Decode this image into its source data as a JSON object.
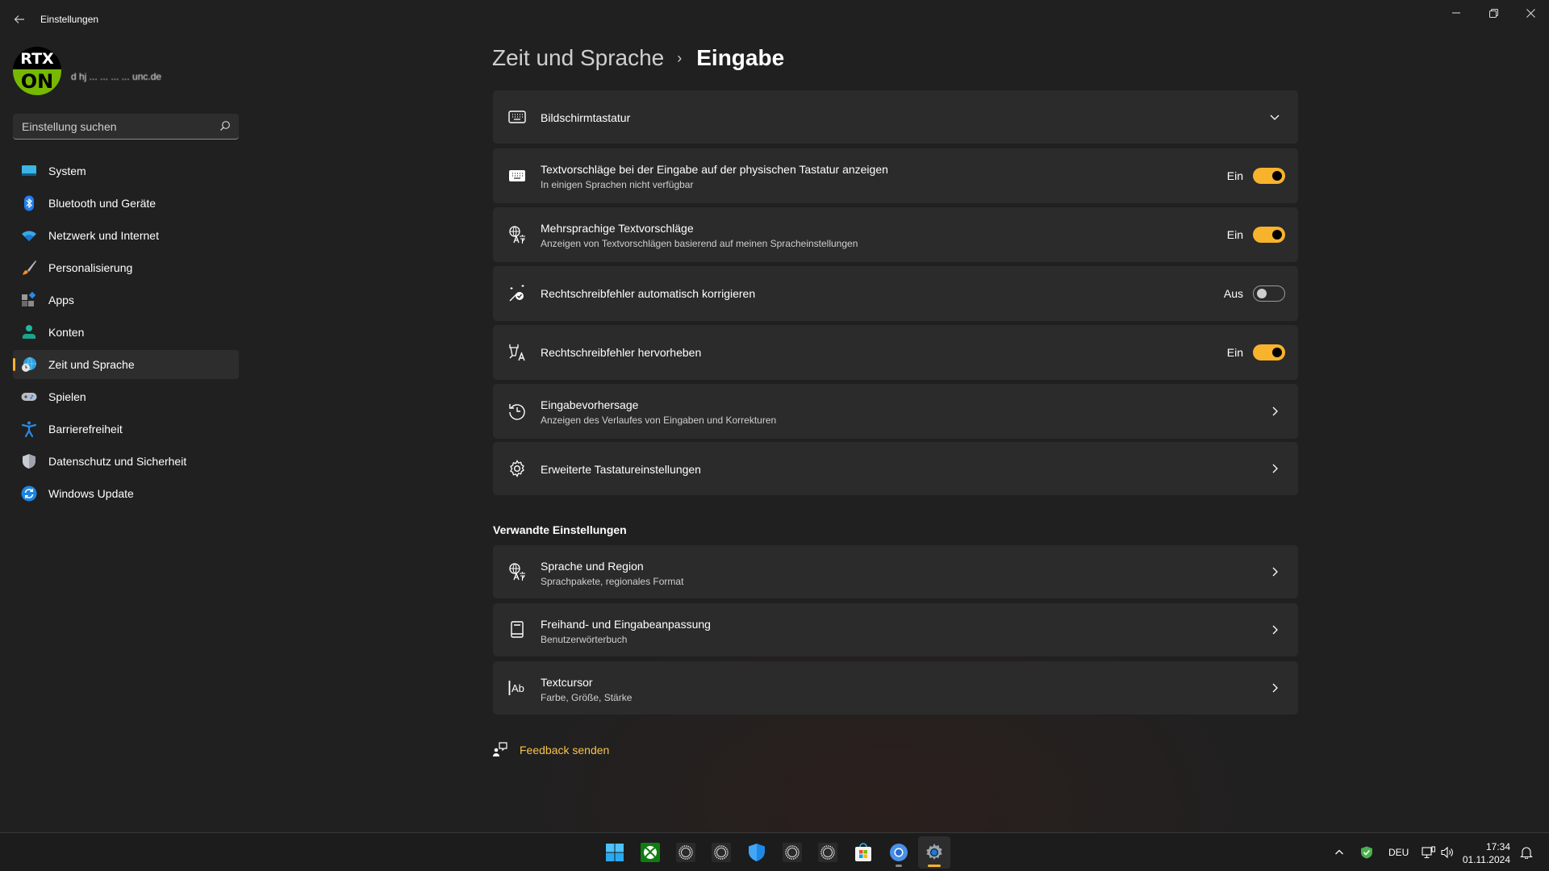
{
  "window": {
    "title": "Einstellungen",
    "back_icon": "arrow-left-icon",
    "controls": {
      "minimize": "minimize-icon",
      "maximize": "restore-icon",
      "close": "close-icon"
    }
  },
  "profile": {
    "avatar_top": "RTX",
    "avatar_bottom": "ON",
    "email": "d  hj  ...  ...  ...  ...  unc.de"
  },
  "search": {
    "placeholder": "Einstellung suchen",
    "icon": "search-icon"
  },
  "sidebar": {
    "items": [
      {
        "label": "System",
        "icon": "system-monitor-icon",
        "active": false
      },
      {
        "label": "Bluetooth und Geräte",
        "icon": "bluetooth-icon",
        "active": false
      },
      {
        "label": "Netzwerk und Internet",
        "icon": "wifi-icon",
        "active": false
      },
      {
        "label": "Personalisierung",
        "icon": "paintbrush-icon",
        "active": false
      },
      {
        "label": "Apps",
        "icon": "apps-icon",
        "active": false
      },
      {
        "label": "Konten",
        "icon": "account-icon",
        "active": false
      },
      {
        "label": "Zeit und Sprache",
        "icon": "globe-clock-icon",
        "active": true
      },
      {
        "label": "Spielen",
        "icon": "gamepad-icon",
        "active": false
      },
      {
        "label": "Barrierefreiheit",
        "icon": "accessibility-icon",
        "active": false
      },
      {
        "label": "Datenschutz und Sicherheit",
        "icon": "shield-icon",
        "active": false
      },
      {
        "label": "Windows Update",
        "icon": "update-icon",
        "active": false
      }
    ]
  },
  "breadcrumb": {
    "parent": "Zeit und Sprache",
    "separator": "›",
    "current": "Eingabe"
  },
  "settings": [
    {
      "title": "Bildschirmtastatur",
      "subtitle": "",
      "icon": "keyboard-outline-icon",
      "control": "expand",
      "state": ""
    },
    {
      "title": "Textvorschläge bei der Eingabe auf der physischen Tastatur anzeigen",
      "subtitle": "In einigen Sprachen nicht verfügbar",
      "icon": "keyboard-filled-icon",
      "control": "toggle",
      "state": "Ein",
      "on": true
    },
    {
      "title": "Mehrsprachige Textvorschläge",
      "subtitle": "Anzeigen von Textvorschlägen basierend auf meinen Spracheinstellungen",
      "icon": "language-icon",
      "control": "toggle",
      "state": "Ein",
      "on": true
    },
    {
      "title": "Rechtschreibfehler automatisch korrigieren",
      "subtitle": "",
      "icon": "autocorrect-icon",
      "control": "toggle",
      "state": "Aus",
      "on": false
    },
    {
      "title": "Rechtschreibfehler hervorheben",
      "subtitle": "",
      "icon": "highlight-text-icon",
      "control": "toggle",
      "state": "Ein",
      "on": true
    },
    {
      "title": "Eingabevorhersage",
      "subtitle": "Anzeigen des Verlaufes von Eingaben und Korrekturen",
      "icon": "history-icon",
      "control": "link",
      "state": ""
    },
    {
      "title": "Erweiterte Tastatureinstellungen",
      "subtitle": "",
      "icon": "gear-icon",
      "control": "link",
      "state": ""
    }
  ],
  "related": {
    "title": "Verwandte Einstellungen",
    "items": [
      {
        "title": "Sprache und Region",
        "subtitle": "Sprachpakete, regionales Format",
        "icon": "language-icon"
      },
      {
        "title": "Freihand- und Eingabeanpassung",
        "subtitle": "Benutzerwörterbuch",
        "icon": "dictionary-icon"
      },
      {
        "title": "Textcursor",
        "subtitle": "Farbe, Größe, Stärke",
        "icon": "text-cursor-icon"
      }
    ]
  },
  "feedback": {
    "label": "Feedback senden",
    "icon": "feedback-icon"
  },
  "colors": {
    "accent": "#f7b32b",
    "link": "#f7c44a",
    "card": "#2b2b2b",
    "background": "#202020"
  },
  "taskbar": {
    "apps": [
      {
        "name": "start",
        "icon": "windows-start-icon"
      },
      {
        "name": "xbox",
        "icon": "xbox-icon"
      },
      {
        "name": "cctx-1",
        "icon": "cctx-icon"
      },
      {
        "name": "cctx-2",
        "icon": "cctx-icon"
      },
      {
        "name": "defender",
        "icon": "defender-shield-icon"
      },
      {
        "name": "cctx-3",
        "icon": "cctx-icon"
      },
      {
        "name": "cctx-4",
        "icon": "cctx-icon"
      },
      {
        "name": "store",
        "icon": "store-icon"
      },
      {
        "name": "chrome",
        "icon": "chromium-icon"
      },
      {
        "name": "settings",
        "icon": "settings-gear-icon"
      }
    ],
    "tray": {
      "language": "DEU",
      "time": "17:34",
      "date": "01.11.2024"
    }
  }
}
